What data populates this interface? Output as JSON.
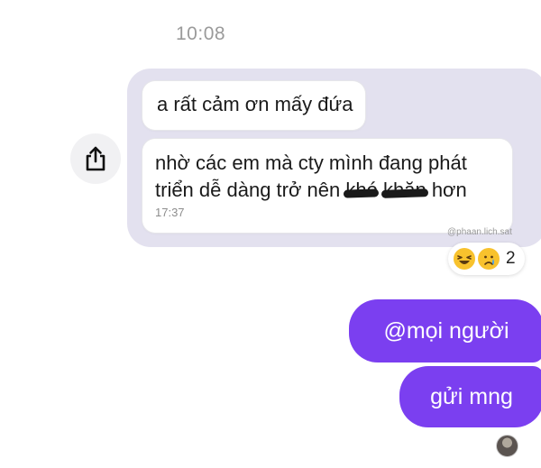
{
  "header": {
    "timestamp": "10:08"
  },
  "icons": {
    "share": "share-icon"
  },
  "forwarded": {
    "message1": "a rất cảm ơn mấy đứa",
    "message2_line1": "nhờ các em mà cty mình đang phát",
    "message2_line2_prefix": "triển dễ dàng trở nên",
    "message2_scribbled_word1": "khó",
    "message2_scribbled_word2": "khăn",
    "message2_line2_suffix": "hơn",
    "message2_time": "17:37",
    "watermark": "@phaan.lich.sat"
  },
  "reactions": {
    "emojis": [
      "laughing-emoji",
      "crying-emoji"
    ],
    "count": "2"
  },
  "outgoing": {
    "bubble1": "@mọi người",
    "bubble2": "gửi mng"
  },
  "colors": {
    "bubble_outgoing": "#7b3ff0",
    "bubble_forward": "#e3e1ef",
    "timestamp": "#9a9a9a"
  }
}
